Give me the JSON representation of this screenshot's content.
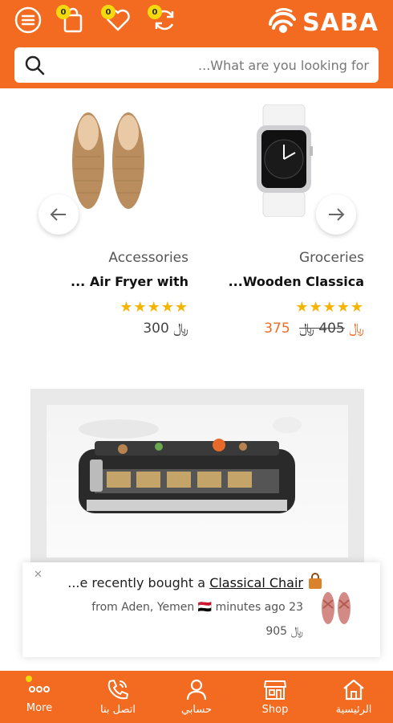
{
  "header": {
    "logo_text": "SABA",
    "cart_count": "0",
    "wishlist_count": "0",
    "compare_count": "0",
    "search_placeholder": "...What are you looking for",
    "accent_color": "#f26b21",
    "icons": [
      "menu-icon",
      "shopping-bag-icon",
      "heart-icon",
      "refresh-icon",
      "search-icon"
    ]
  },
  "products": [
    {
      "category": "Accessories",
      "name": "... Air Fryer with",
      "rating": 5,
      "stars": "★★★★★",
      "price": "300 ﷼"
    },
    {
      "category": "Groceries",
      "name": "...Wooden Classica",
      "rating": 5,
      "stars": "★★★★★",
      "price": "375 ﷼",
      "old_price": "405 ﷼"
    }
  ],
  "toast": {
    "close": "✕",
    "prefix": "...e recently bought a ",
    "product": "Classical Chair",
    "location": "from Aden, Yemen 🇾🇪 minutes ago 23",
    "price": "905 ﷼"
  },
  "bottom_nav": [
    {
      "label": "More",
      "icon": "more-dots-icon"
    },
    {
      "label": "اتصل بنا",
      "icon": "phone-icon"
    },
    {
      "label": "حسابي",
      "icon": "user-icon"
    },
    {
      "label": "Shop",
      "icon": "store-icon"
    },
    {
      "label": "الرئيسية",
      "icon": "home-icon"
    }
  ]
}
